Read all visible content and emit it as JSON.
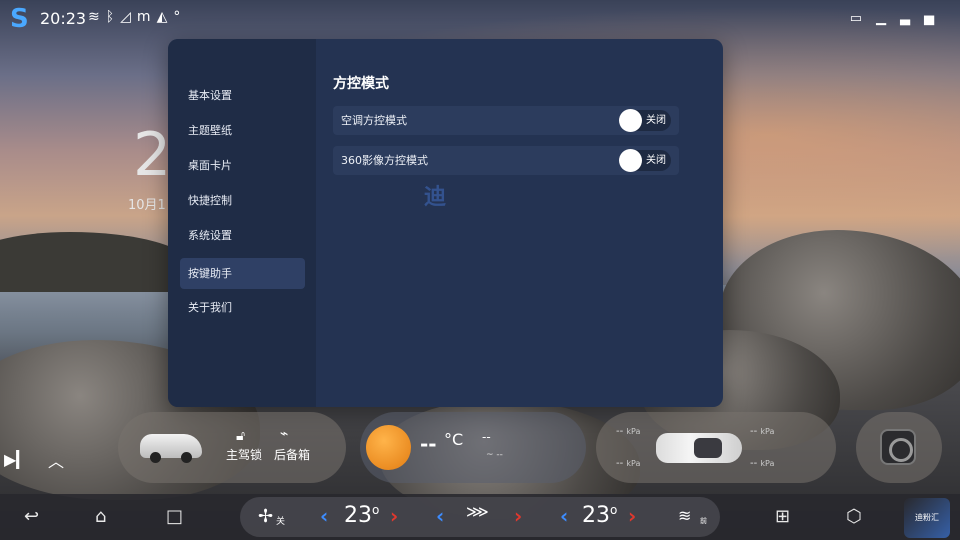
{
  "status_bar": {
    "time": "20:23",
    "icons": [
      "wifi-icon",
      "bluetooth-icon",
      "signal-icon",
      "m",
      "warning-icon",
      "°"
    ],
    "right_icons": [
      "dashcam-icon",
      "signal-bars-icon"
    ]
  },
  "home_widget": {
    "big_digit": "2",
    "date_peek": "10月1"
  },
  "dialog": {
    "sidebar": {
      "items": [
        {
          "label": "基本设置"
        },
        {
          "label": "主题壁纸"
        },
        {
          "label": "桌面卡片"
        },
        {
          "label": "快捷控制"
        },
        {
          "label": "系统设置"
        },
        {
          "label": "按键助手",
          "active": true
        },
        {
          "label": "关于我们"
        }
      ]
    },
    "content": {
      "title": "方控模式",
      "options": [
        {
          "label": "空调方控模式",
          "switch_text": "关闭",
          "on": false
        },
        {
          "label": "360影像方控模式",
          "switch_text": "关闭",
          "on": false
        }
      ],
      "watermark": "迪"
    }
  },
  "cards": {
    "vehicle": {
      "lock_label": "主驾锁",
      "trunk_label": "后备箱"
    },
    "weather": {
      "temp": "--",
      "unit": "°C",
      "extra": "--",
      "extra_small": "~ --"
    },
    "tires": {
      "fl": "--",
      "fr": "--",
      "rl": "--",
      "rr": "--",
      "unit": "kPa"
    }
  },
  "dock": {
    "fan_label": "关",
    "left_temp": "23",
    "right_temp": "23",
    "degree": "o",
    "defrost_label": "前",
    "corner_badge": "迪粉汇"
  },
  "colors": {
    "dialog_bg": "#243352",
    "sidebar_bg": "#1f2c46",
    "accent_blue": "#3d8cff",
    "accent_red": "#e0382e"
  }
}
